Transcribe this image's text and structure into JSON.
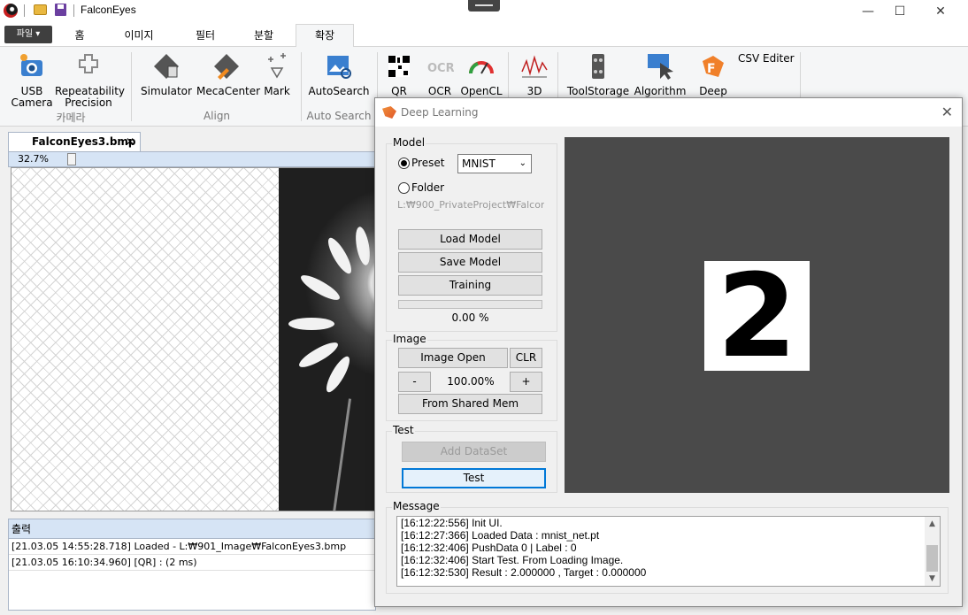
{
  "titlebar": {
    "title": "FalconEyes",
    "minimize": "—",
    "maximize": "☐",
    "close": "✕"
  },
  "ribbon_tabs": {
    "file": "파일 ▾",
    "tabs": [
      "홈",
      "이미지",
      "필터",
      "분할",
      "확장"
    ],
    "active": "확장"
  },
  "ribbon": {
    "groups": {
      "camera": "카메라",
      "align": "Align",
      "auto_search": "Auto Search"
    },
    "buttons": {
      "usb_camera": "USB\nCamera",
      "repeatability": "Repeatability\nPrecision",
      "simulator": "Simulator",
      "mecacenter": "MecaCenter",
      "mark": "Mark",
      "autosearch": "AutoSearch",
      "qr": "QR",
      "ocr": "OCR",
      "opencl": "OpenCL",
      "3d": "3D",
      "toolstorage": "ToolStorage",
      "algorithm": "Algorithm",
      "deep": "Deep",
      "csv_editer": "CSV Editer"
    }
  },
  "document": {
    "tab_name": "FalconEyes3.bmp",
    "tab_close": "✕",
    "zoom": "32.7%"
  },
  "output": {
    "header": "출력",
    "rows": [
      "[21.03.05 14:55:28.718] Loaded - L:₩901_Image₩FalconEyes3.bmp",
      "[21.03.05 16:10:34.960] [QR] :  (2 ms)"
    ]
  },
  "dialog": {
    "title": "Deep Learning",
    "close": "✕",
    "model": {
      "label": "Model",
      "preset_label": "Preset",
      "preset_value": "MNIST",
      "folder_label": "Folder",
      "folder_path": "L:₩900_PrivateProject₩Falcon",
      "load_model": "Load Model",
      "save_model": "Save Model",
      "training": "Training",
      "progress_text": "0.00 %",
      "progress": 0.0
    },
    "image": {
      "label": "Image",
      "open": "Image Open",
      "clr": "CLR",
      "minus": "-",
      "zoom": "100.00%",
      "plus": "+",
      "shared_mem": "From Shared Mem"
    },
    "test": {
      "label": "Test",
      "add_dataset": "Add DataSet",
      "test": "Test"
    },
    "viewer": {
      "digit": "2"
    },
    "message": {
      "label": "Message",
      "lines": [
        "[16:12:22:556] Init UI.",
        "[16:12:27:366] Loaded Data : mnist_net.pt",
        "[16:12:32:406] PushData 0 | Label : 0",
        "[16:12:32:406] Start Test. From Loading Image.",
        "[16:12:32:530] Result : 2.000000 , Target : 0.000000"
      ]
    }
  },
  "colors": {
    "accent": "#0078d7",
    "viewer_bg": "#4a4a4a",
    "panel_head": "#d6e4f5"
  }
}
